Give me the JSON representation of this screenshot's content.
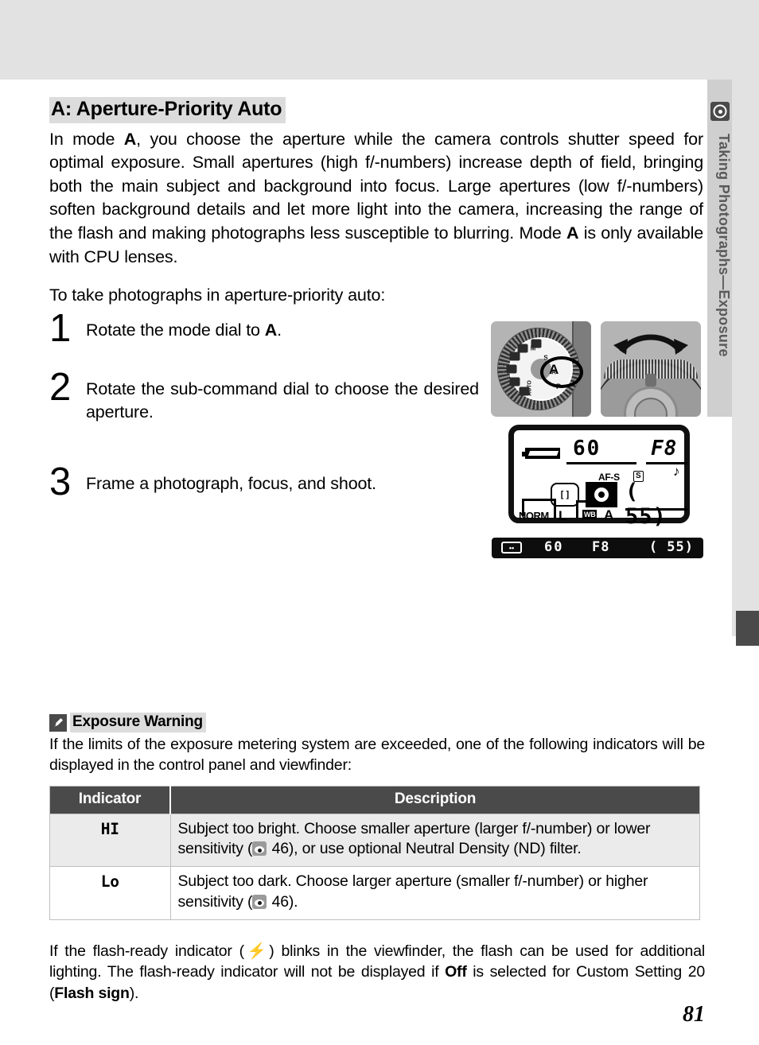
{
  "section": {
    "title": "A: Aperture-Priority Auto",
    "intro_html": "In mode <b>A</b>, you choose the aperture while the camera controls shutter speed for optimal exposure.  Small apertures (high f/-numbers) increase depth of field, bringing both the main subject and background into focus.  Large apertures (low f/-numbers) soften background details and let more light into the camera, increasing the range of the flash and making photographs less susceptible to blurring.  Mode <b>A</b> is only available with CPU lenses.",
    "lead": "To take photographs in aperture-priority auto:"
  },
  "steps": [
    {
      "number": "1",
      "text_html": "Rotate the mode dial to <b>A</b>."
    },
    {
      "number": "2",
      "text_html": "Rotate the sub-command dial to choose the desired aperture."
    },
    {
      "number": "3",
      "text_html": "Frame a photograph, focus, and shoot."
    }
  ],
  "illustrations": {
    "mode_dial": {
      "selected_mode": "A",
      "modes": [
        "AUTO",
        "P",
        "A",
        "S",
        "M"
      ]
    },
    "sub_command_dial": {
      "arrow": "rotate-both-directions"
    }
  },
  "control_panel": {
    "shutter_speed": "60",
    "aperture": "F8",
    "focus_mode": "AF-S",
    "release_mode": "S",
    "frames_remaining": "( 55)",
    "quality": "NORM",
    "image_size": "L",
    "white_balance_label": "WB",
    "white_balance_value": "A",
    "beep": "♪",
    "focus_brackets": "[ ]"
  },
  "viewfinder": {
    "shutter_speed": "60",
    "aperture": "F8",
    "frames_remaining": "( 55)"
  },
  "note": {
    "title": "Exposure Warning",
    "body": "If the limits of the exposure metering system are exceeded, one of the following indicators will be displayed in the control panel and viewfinder:"
  },
  "table": {
    "headers": [
      "Indicator",
      "Description"
    ],
    "rows": [
      {
        "indicator": "HI",
        "description_pre": "Subject too bright.  Choose smaller aperture (larger f/-number) or lower sensitivity (",
        "description_page": "46",
        "description_post": "), or use optional Neutral Density (ND) filter."
      },
      {
        "indicator": "Lo",
        "description_pre": "Subject too dark.  Choose larger aperture (smaller f/-number) or higher sensitivity (",
        "description_page": "46",
        "description_post": ")."
      }
    ]
  },
  "tail": {
    "text_html": "If the flash-ready indicator (<span class=\"bolt\">⚡</span>) blinks in the viewfinder, the flash can be used for additional lighting.  The flash-ready indicator will not be displayed if <b>Off</b> is selected for Custom Setting 20 (<b>Flash sign</b>)."
  },
  "side_tab": {
    "label": "Taking Photographs—Exposure",
    "icon": "camera-metering-icon"
  },
  "footer": {
    "page_number": "81"
  },
  "colors": {
    "band": "#e2e2e2",
    "highlight": "#dcdcdc",
    "table_header": "#4a4a4a",
    "row_alt": "#ebebeb",
    "side_tab": "#cfcfcf",
    "side_text": "#5a5a5a"
  }
}
